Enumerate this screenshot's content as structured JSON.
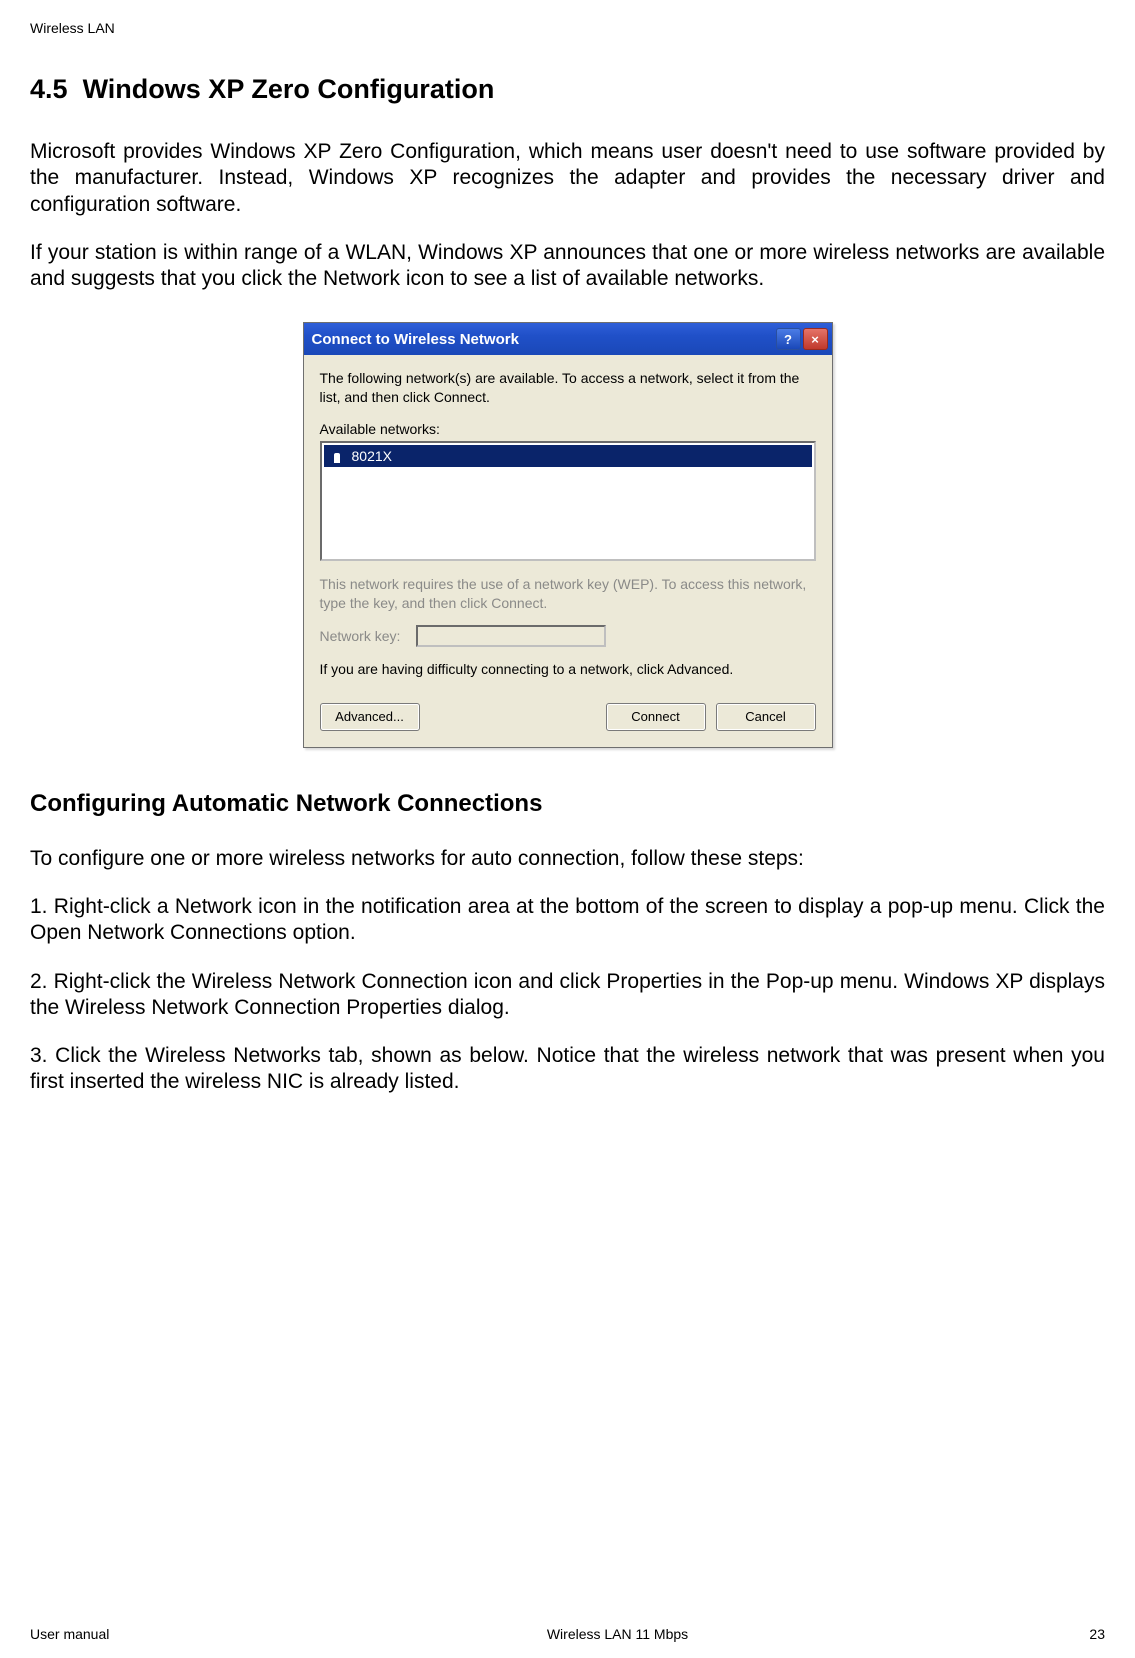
{
  "header": "Wireless LAN",
  "section": {
    "number": "4.5",
    "title": "Windows XP  Zero Configuration"
  },
  "paragraphs": {
    "p1": "Microsoft provides Windows XP Zero Configuration, which means user doesn't need to use software provided by the manufacturer. Instead, Windows XP recognizes the adapter and provides the necessary driver and configuration software.",
    "p2": "If your station is within range of a WLAN, Windows XP announces that one or more wireless networks are available and suggests that you click the Network icon to see a list of available networks."
  },
  "dialog": {
    "title": "Connect to Wireless Network",
    "help_symbol": "?",
    "close_symbol": "×",
    "lead": "The following network(s) are available. To access a network, select it from the list, and then click Connect.",
    "available_label": "Available networks:",
    "networks": [
      {
        "name": "8021X"
      }
    ],
    "wep_text": "This network requires the use of a network key (WEP). To access this network, type the key, and then click Connect.",
    "key_label": "Network key:",
    "diff_text": "If you are having difficulty connecting to a network, click Advanced.",
    "buttons": {
      "advanced": "Advanced...",
      "connect": "Connect",
      "cancel": "Cancel"
    }
  },
  "subsection": "Configuring Automatic Network Connections",
  "steps": {
    "intro": "To configure one or more wireless networks for auto connection, follow these steps:",
    "s1": "1. Right-click a Network icon in the notification area at the bottom of the screen to display a pop-up menu. Click the Open Network Connections option.",
    "s2": "2. Right-click the Wireless Network Connection icon and click Properties in the Pop-up menu. Windows XP displays the Wireless Network Connection Properties dialog.",
    "s3": "3. Click the Wireless Networks tab, shown as below. Notice that the wireless network that was present when you first inserted the wireless NIC is already listed."
  },
  "footer": {
    "left": "User manual",
    "center": "Wireless LAN 11 Mbps",
    "right": "23"
  }
}
